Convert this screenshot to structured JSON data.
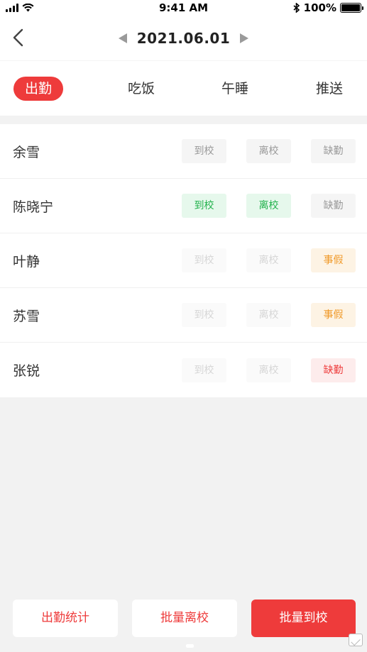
{
  "status_bar": {
    "time": "9:41 AM",
    "battery_percent": "100%"
  },
  "header": {
    "date": "2021.06.01"
  },
  "tabs": [
    {
      "label": "出勤",
      "active": true
    },
    {
      "label": "吃饭",
      "active": false
    },
    {
      "label": "午睡",
      "active": false
    },
    {
      "label": "推送",
      "active": false
    }
  ],
  "students": [
    {
      "name": "余雪",
      "buttons": [
        {
          "label": "到校",
          "state": "gray"
        },
        {
          "label": "离校",
          "state": "gray"
        },
        {
          "label": "缺勤",
          "state": "gray"
        }
      ]
    },
    {
      "name": "陈晓宁",
      "buttons": [
        {
          "label": "到校",
          "state": "green"
        },
        {
          "label": "离校",
          "state": "green"
        },
        {
          "label": "缺勤",
          "state": "gray"
        }
      ]
    },
    {
      "name": "叶静",
      "buttons": [
        {
          "label": "到校",
          "state": "faded"
        },
        {
          "label": "离校",
          "state": "faded"
        },
        {
          "label": "事假",
          "state": "orange"
        }
      ]
    },
    {
      "name": "苏雪",
      "buttons": [
        {
          "label": "到校",
          "state": "faded"
        },
        {
          "label": "离校",
          "state": "faded"
        },
        {
          "label": "事假",
          "state": "orange"
        }
      ]
    },
    {
      "name": "张锐",
      "buttons": [
        {
          "label": "到校",
          "state": "faded"
        },
        {
          "label": "离校",
          "state": "faded"
        },
        {
          "label": "缺勤",
          "state": "red"
        }
      ]
    }
  ],
  "bottom_actions": {
    "stats_label": "出勤统计",
    "batch_leave_label": "批量离校",
    "batch_arrive_label": "批量到校"
  },
  "colors": {
    "accent": "#ee3b3b",
    "green": "#22b24c",
    "orange": "#f09a2a"
  }
}
